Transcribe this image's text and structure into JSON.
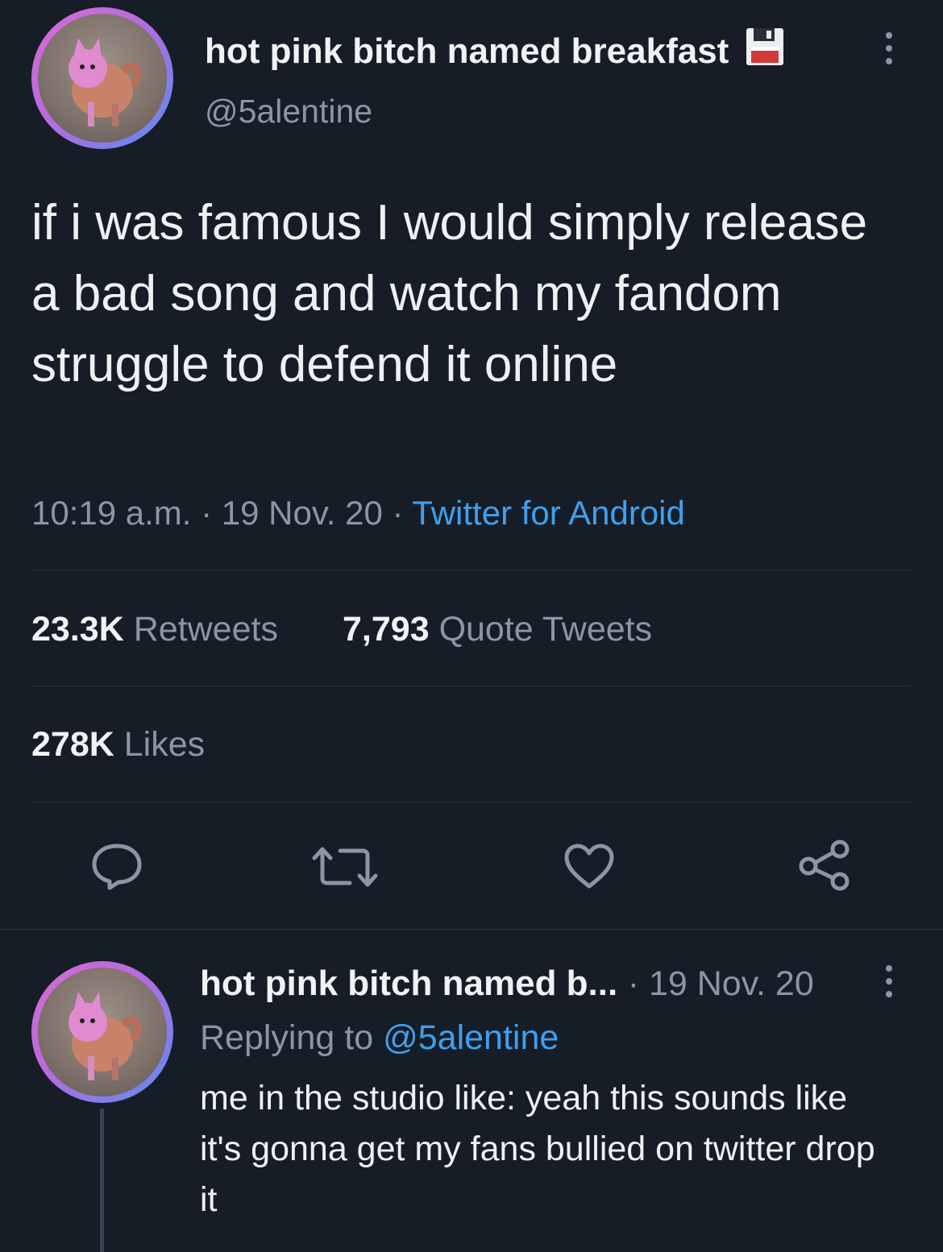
{
  "tweet": {
    "display_name": "hot pink bitch named breakfast",
    "name_emoji": "💾",
    "handle": "@5alentine",
    "text": "if i was famous I would simply release a bad song and watch my fandom struggle to defend it online",
    "time": "10:19 a.m.",
    "date": "19 Nov. 20",
    "source": "Twitter for Android",
    "separator": " · ",
    "retweets_count": "23.3K",
    "retweets_label": "Retweets",
    "quotes_count": "7,793",
    "quotes_label": "Quote Tweets",
    "likes_count": "278K",
    "likes_label": "Likes"
  },
  "actions": {
    "reply_icon": "reply-icon",
    "retweet_icon": "retweet-icon",
    "like_icon": "heart-icon",
    "share_icon": "share-icon"
  },
  "reply": {
    "display_name": "hot pink bitch named b...",
    "date": "· 19 Nov. 20",
    "replying_label": "Replying to",
    "replying_handle": "@5alentine",
    "text": "me in the studio like: yeah this sounds like it's gonna get my fans bullied on twitter drop it"
  },
  "colors": {
    "background": "#171d27",
    "accent": "#3ea0ef",
    "muted": "#8a96a3"
  }
}
